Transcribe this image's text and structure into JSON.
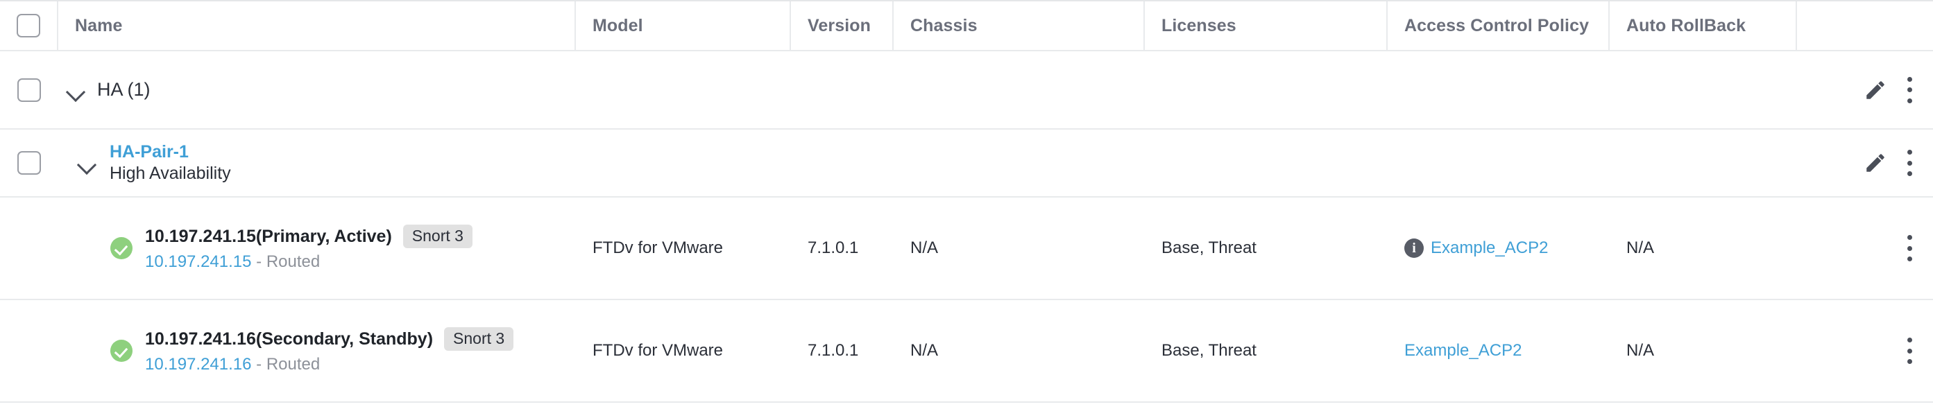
{
  "table": {
    "columns": [
      {
        "key": "name",
        "label": "Name"
      },
      {
        "key": "model",
        "label": "Model"
      },
      {
        "key": "version",
        "label": "Version"
      },
      {
        "key": "chassis",
        "label": "Chassis"
      },
      {
        "key": "licenses",
        "label": "Licenses"
      },
      {
        "key": "acp",
        "label": "Access Control Policy"
      },
      {
        "key": "rollback",
        "label": "Auto RollBack"
      }
    ],
    "group": {
      "label": "HA (1)",
      "expanded": true,
      "chevron_icon": "chevron-down-icon",
      "edit_icon": "pencil-icon",
      "menu_icon": "kebab-menu-icon"
    },
    "pair": {
      "title": "HA-Pair-1",
      "subtitle": "High Availability",
      "expanded": true,
      "chevron_icon": "chevron-down-icon",
      "edit_icon": "pencil-icon",
      "menu_icon": "kebab-menu-icon"
    },
    "devices": [
      {
        "status_icon": "status-ok-icon",
        "name": "10.197.241.15(Primary, Active)",
        "badge": "Snort 3",
        "ip": "10.197.241.15",
        "mode": " - Routed",
        "model": "FTDv for VMware",
        "version": "7.1.0.1",
        "chassis": "N/A",
        "licenses": "Base, Threat",
        "acp": "Example_ACP2",
        "acp_has_info": true,
        "acp_info_glyph": "i",
        "rollback": "N/A",
        "menu_icon": "kebab-menu-icon"
      },
      {
        "status_icon": "status-ok-icon",
        "name": "10.197.241.16(Secondary, Standby)",
        "badge": "Snort 3",
        "ip": "10.197.241.16",
        "mode": " - Routed",
        "model": "FTDv for VMware",
        "version": "7.1.0.1",
        "chassis": "N/A",
        "licenses": "Base, Threat",
        "acp": "Example_ACP2",
        "acp_has_info": false,
        "acp_info_glyph": "",
        "rollback": "N/A",
        "menu_icon": "kebab-menu-icon"
      }
    ]
  },
  "colors": {
    "link": "#3f9fd6",
    "status_ok": "#8ed07e",
    "badge_bg": "#e1e1e1",
    "header_text": "#6b6f7b",
    "border": "#e8eaec"
  }
}
